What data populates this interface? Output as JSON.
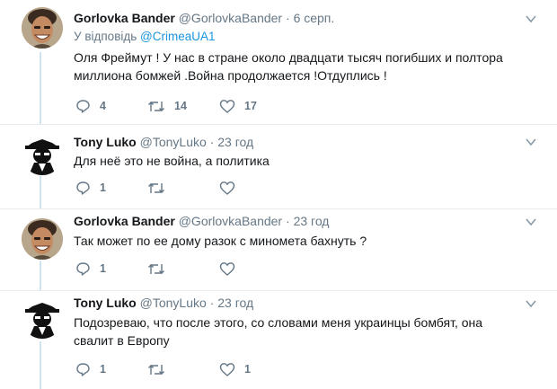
{
  "tweets": [
    {
      "name": "Gorlovka Bander",
      "handle": "@GorlovkaBander",
      "separator": "·",
      "time": "6 серп.",
      "reply_prefix": "У відповідь",
      "reply_mention": "@CrimeaUA1",
      "text": "Оля Фреймут ! У нас в стране около двадцати тысяч погибших и полтора миллиона бомжей .Война продолжается !Отдуплись !",
      "replies": "4",
      "retweets": "14",
      "likes": "17",
      "avatar": "man-smiling-avatar"
    },
    {
      "name": "Tony Luko",
      "handle": "@TonyLuko",
      "separator": "·",
      "time": "23 год",
      "text": "Для неё это не война, а политика",
      "replies": "1",
      "retweets": "",
      "likes": "",
      "avatar": "masked-figure-avatar"
    },
    {
      "name": "Gorlovka Bander",
      "handle": "@GorlovkaBander",
      "separator": "·",
      "time": "23 год",
      "text": "Так может по ее дому разок с миномета бахнуть ?",
      "replies": "1",
      "retweets": "",
      "likes": "",
      "avatar": "man-smiling-avatar"
    },
    {
      "name": "Tony Luko",
      "handle": "@TonyLuko",
      "separator": "·",
      "time": "23 год",
      "text": "Подозреваю, что после этого, со словами меня украинцы бомбят, она свалит в Европу",
      "replies": "1",
      "retweets": "",
      "likes": "1",
      "avatar": "masked-figure-avatar"
    }
  ],
  "colors": {
    "text": "#14171a",
    "secondary": "#657786",
    "link": "#1b95e0",
    "thread_line": "#cfe3ee",
    "divider": "#e6ecf0"
  }
}
